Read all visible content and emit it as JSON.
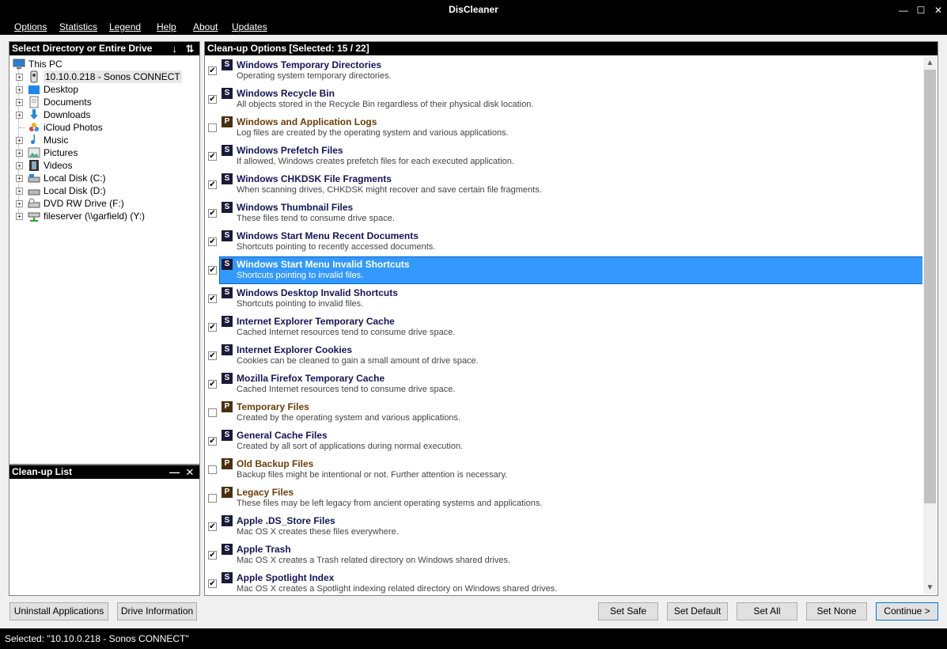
{
  "window": {
    "title": "DisCleaner"
  },
  "menu": [
    "Options",
    "Statistics",
    "Legend",
    "Help",
    "About",
    "Updates"
  ],
  "left_panel": {
    "header": "Select Directory or Entire Drive",
    "tree": [
      {
        "label": "This PC",
        "icon": "computer-icon"
      },
      {
        "label": "10.10.0.218 - Sonos CONNECT",
        "icon": "media-device-icon"
      },
      {
        "label": "Desktop",
        "icon": "desktop-folder-icon"
      },
      {
        "label": "Documents",
        "icon": "documents-icon"
      },
      {
        "label": "Downloads",
        "icon": "download-arrow-icon"
      },
      {
        "label": "iCloud Photos",
        "icon": "photos-icon"
      },
      {
        "label": "Music",
        "icon": "music-note-icon"
      },
      {
        "label": "Pictures",
        "icon": "pictures-icon"
      },
      {
        "label": "Videos",
        "icon": "film-icon"
      },
      {
        "label": "Local Disk (C:)",
        "icon": "hard-drive-icon"
      },
      {
        "label": "Local Disk (D:)",
        "icon": "hard-drive-icon"
      },
      {
        "label": "DVD RW Drive (F:)",
        "icon": "dvd-drive-icon"
      },
      {
        "label": "fileserver (\\\\garfield) (Y:)",
        "icon": "network-drive-icon"
      }
    ]
  },
  "cleanup_list": {
    "header": "Clean-up List"
  },
  "options_panel": {
    "header": "Clean-up Options [Selected: 15 / 22]",
    "items": [
      {
        "badge": "S",
        "title": "Windows Temporary Directories",
        "desc": "Operating system temporary directories.",
        "checked": true
      },
      {
        "badge": "S",
        "title": "Windows Recycle Bin",
        "desc": "All objects stored in the Recycle Bin regardless of their physical disk location.",
        "checked": true
      },
      {
        "badge": "P",
        "title": "Windows and Application Logs",
        "desc": "Log files are created by the operating system and various applications.",
        "checked": false
      },
      {
        "badge": "S",
        "title": "Windows Prefetch Files",
        "desc": "If allowed, Windows creates prefetch files for each executed application.",
        "checked": true
      },
      {
        "badge": "S",
        "title": "Windows CHKDSK File Fragments",
        "desc": "When scanning drives, CHKDSK might recover and save certain file fragments.",
        "checked": true
      },
      {
        "badge": "S",
        "title": "Windows Thumbnail Files",
        "desc": "These files tend to consume drive space.",
        "checked": true
      },
      {
        "badge": "S",
        "title": "Windows Start Menu Recent Documents",
        "desc": "Shortcuts pointing to recently accessed documents.",
        "checked": true
      },
      {
        "badge": "S",
        "title": "Windows Start Menu Invalid Shortcuts",
        "desc": "Shortcuts pointing to invalid files.",
        "checked": true,
        "selected": true
      },
      {
        "badge": "S",
        "title": "Windows Desktop Invalid Shortcuts",
        "desc": "Shortcuts pointing to invalid files.",
        "checked": true
      },
      {
        "badge": "S",
        "title": "Internet Explorer Temporary Cache",
        "desc": "Cached Internet resources tend to consume drive space.",
        "checked": true
      },
      {
        "badge": "S",
        "title": "Internet Explorer Cookies",
        "desc": "Cookies can be cleaned to gain a small amount of drive space.",
        "checked": true
      },
      {
        "badge": "S",
        "title": "Mozilla Firefox Temporary Cache",
        "desc": "Cached Internet resources tend to consume drive space.",
        "checked": true
      },
      {
        "badge": "P",
        "title": "Temporary Files",
        "desc": "Created by the operating system and various applications.",
        "checked": false
      },
      {
        "badge": "S",
        "title": "General Cache Files",
        "desc": "Created by all sort of applications during normal execution.",
        "checked": true
      },
      {
        "badge": "P",
        "title": "Old Backup Files",
        "desc": "Backup files might be intentional or not. Further attention is necessary.",
        "checked": false
      },
      {
        "badge": "P",
        "title": "Legacy Files",
        "desc": "These files may be left legacy from ancient operating systems and applications.",
        "checked": false
      },
      {
        "badge": "S",
        "title": "Apple .DS_Store Files",
        "desc": "Mac OS X creates these files everywhere.",
        "checked": true
      },
      {
        "badge": "S",
        "title": "Apple Trash",
        "desc": "Mac OS X creates a Trash related directory on Windows shared drives.",
        "checked": true
      },
      {
        "badge": "S",
        "title": "Apple Spotlight Index",
        "desc": "Mac OS X creates a Spotlight indexing related directory on Windows shared drives.",
        "checked": true
      }
    ]
  },
  "buttons": {
    "uninstall": "Uninstall Applications",
    "drive_info": "Drive Information",
    "set_safe": "Set Safe",
    "set_default": "Set Default",
    "set_all": "Set All",
    "set_none": "Set None",
    "continue": "Continue >"
  },
  "status": "Selected: \"10.10.0.218 - Sonos CONNECT\"",
  "colors": {
    "accent_selection": "#3399ff",
    "system_badge": "#1a1a3a",
    "potential_badge": "#4a3010"
  }
}
